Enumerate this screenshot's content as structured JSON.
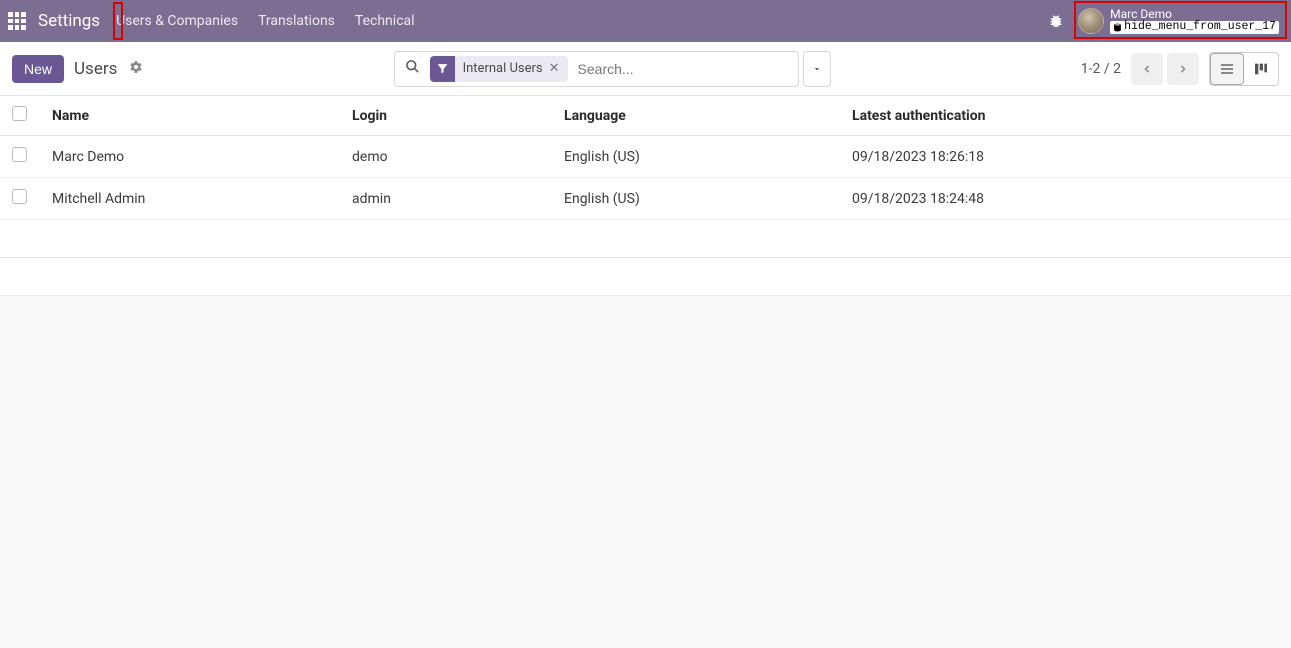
{
  "navbar": {
    "brand": "Settings",
    "items": [
      "Users & Companies",
      "Translations",
      "Technical"
    ],
    "user": {
      "name": "Marc Demo",
      "db": "hide_menu_from_user_17"
    }
  },
  "controlbar": {
    "new_label": "New",
    "breadcrumb": "Users",
    "filter_chip": "Internal Users",
    "search_placeholder": "Search...",
    "pager": "1-2 / 2"
  },
  "table": {
    "headers": {
      "name": "Name",
      "login": "Login",
      "language": "Language",
      "last_auth": "Latest authentication"
    },
    "rows": [
      {
        "name": "Marc Demo",
        "login": "demo",
        "language": "English (US)",
        "last_auth": "09/18/2023 18:26:18"
      },
      {
        "name": "Mitchell Admin",
        "login": "admin",
        "language": "English (US)",
        "last_auth": "09/18/2023 18:24:48"
      }
    ]
  }
}
